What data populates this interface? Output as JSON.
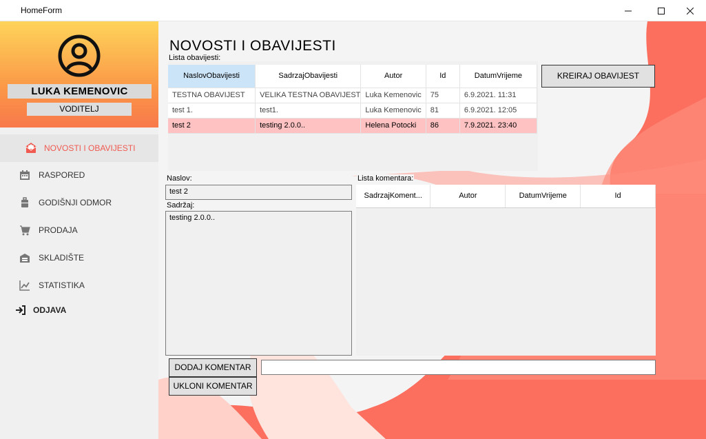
{
  "window": {
    "title": "HomeForm"
  },
  "profile": {
    "name": "LUKA KEMENOVIC",
    "role": "VODITELJ"
  },
  "nav": {
    "items": [
      {
        "label": "NOVOSTI I OBAVIJESTI",
        "icon": "mail-open-icon",
        "active": true
      },
      {
        "label": "RASPORED",
        "icon": "calendar-icon"
      },
      {
        "label": "GODIŠNJI ODMOR",
        "icon": "luggage-icon"
      },
      {
        "label": "PRODAJA",
        "icon": "cart-icon"
      },
      {
        "label": "SKLADIŠTE",
        "icon": "warehouse-icon"
      },
      {
        "label": "STATISTIKA",
        "icon": "chart-line-icon"
      }
    ],
    "logout": {
      "label": "ODJAVA",
      "icon": "sign-out-icon"
    }
  },
  "main": {
    "heading": "NOVOSTI I OBAVIJESTI",
    "list_label": "Lista obavijesti:",
    "create_button": "KREIRAJ OBAVIJEST",
    "announcements": {
      "columns": [
        "NaslovObavijesti",
        "SadrzajObavijesti",
        "Autor",
        "Id",
        "DatumVrijeme"
      ],
      "rows": [
        {
          "title": "TESTNA OBAVIJEST",
          "content": "VELIKA TESTNA OBAVIJEST",
          "author": "Luka Kemenovic",
          "id": "75",
          "datetime": "6.9.2021. 11:31"
        },
        {
          "title": "test 1.",
          "content": "test1.",
          "author": "Luka Kemenovic",
          "id": "81",
          "datetime": "6.9.2021. 12:05"
        },
        {
          "title": "test 2",
          "content": "testing 2.0.0..",
          "author": "Helena Potocki",
          "id": "86",
          "datetime": "7.9.2021. 23:40"
        }
      ]
    },
    "naslov_label": "Naslov:",
    "naslov_value": "test 2",
    "sadrzaj_label": "Sadržaj:",
    "sadrzaj_value": "testing 2.0.0..",
    "comments_label": "Lista komentara:",
    "comments_columns": [
      "SadrzajKoment...",
      "Autor",
      "DatumVrijeme",
      "Id"
    ],
    "add_comment_button": "DODAJ KOMENTAR",
    "remove_comment_button": "UKLONI KOMENTAR",
    "comment_input_value": ""
  },
  "colors": {
    "accent": "#f05a50",
    "highlight_row": "#ffc2c2",
    "selected_header": "#cce4f7"
  }
}
